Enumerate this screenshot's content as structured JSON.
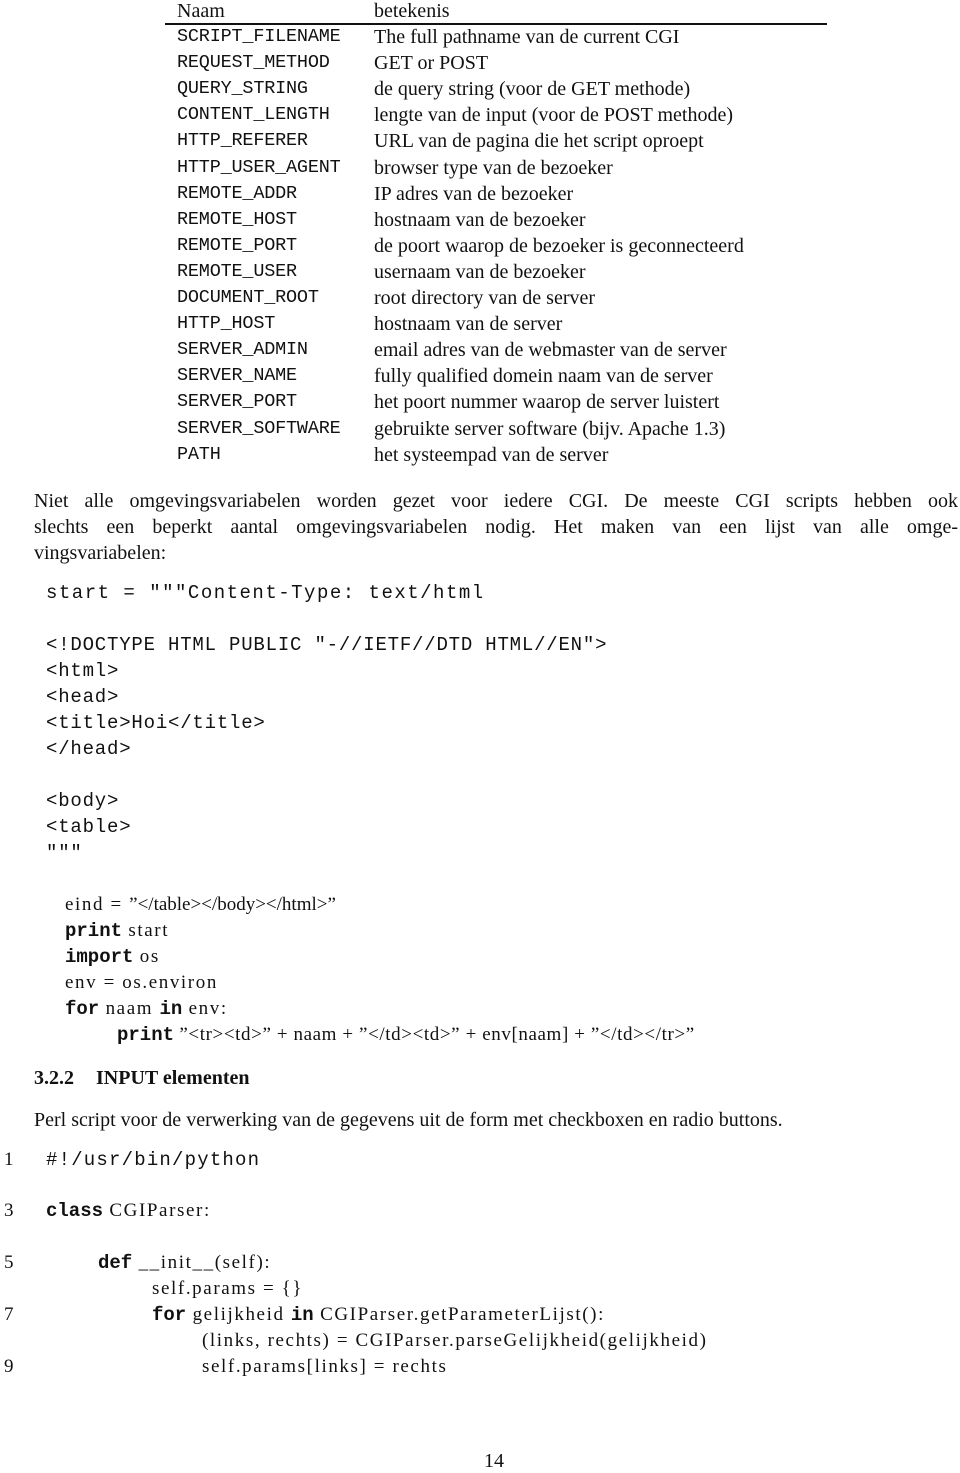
{
  "env_table": {
    "headers": {
      "name": "Naam",
      "meaning": "betekenis"
    },
    "rows": [
      {
        "name": "SCRIPT_FILENAME",
        "meaning": "The full pathname van de current CGI"
      },
      {
        "name": "REQUEST_METHOD",
        "meaning": "GET or POST"
      },
      {
        "name": "QUERY_STRING",
        "meaning": "de query string (voor de GET methode)"
      },
      {
        "name": "CONTENT_LENGTH",
        "meaning": "lengte van de input (voor de POST methode)"
      },
      {
        "name": "HTTP_REFERER",
        "meaning": "URL van de pagina die het script oproept"
      },
      {
        "name": "HTTP_USER_AGENT",
        "meaning": "browser type van de bezoeker"
      },
      {
        "name": "REMOTE_ADDR",
        "meaning": "IP adres van de bezoeker"
      },
      {
        "name": "REMOTE_HOST",
        "meaning": "hostnaam van de bezoeker"
      },
      {
        "name": "REMOTE_PORT",
        "meaning": "de poort waarop de bezoeker is geconnecteerd"
      },
      {
        "name": "REMOTE_USER",
        "meaning": "usernaam van de bezoeker"
      },
      {
        "name": "DOCUMENT_ROOT",
        "meaning": "root directory van de server"
      },
      {
        "name": "HTTP_HOST",
        "meaning": "hostnaam van de server"
      },
      {
        "name": "SERVER_ADMIN",
        "meaning": "email adres van de webmaster van de server"
      },
      {
        "name": "SERVER_NAME",
        "meaning": "fully qualified domein naam van de server"
      },
      {
        "name": "SERVER_PORT",
        "meaning": "het poort nummer waarop de server luistert"
      },
      {
        "name": "SERVER_SOFTWARE",
        "meaning": "gebruikte server software (bijv. Apache 1.3)"
      },
      {
        "name": "PATH",
        "meaning": "het systeempad van de server"
      }
    ]
  },
  "paragraph1": {
    "lines": [
      "Niet alle omgevingsvariabelen worden gezet voor iedere CGI. De meeste CGI scripts hebben ook",
      "slechts een beperkt aantal omgevingsvariabelen nodig. Het maken van een lijst van alle omge-",
      "vingsvariabelen:"
    ]
  },
  "code1": {
    "start_line": "start = \"\"\"Content-Type: text/html",
    "html_lines": [
      "<!DOCTYPE HTML PUBLIC \"-//IETF//DTD HTML//EN\">",
      "<html>",
      "<head>",
      "<title>Hoi</title>",
      "</head>",
      "",
      "<body>",
      "<table>",
      "\"\"\""
    ],
    "eind": {
      "var": "eind = ",
      "value": "”</table></body></html>”"
    },
    "print_start": {
      "kw": "print",
      "rest": " start"
    },
    "import_os": {
      "kw": "import",
      "rest": " os"
    },
    "env_line": "env = os.environ",
    "for_line": {
      "kw1": "for",
      "mid": " naam ",
      "kw2": "in",
      "rest": " env:"
    },
    "print_row": {
      "kw": "print",
      "rest": " ”<tr><td>” + naam + ”</td><td>” + env[naam] + ”</td></tr>”"
    }
  },
  "section": {
    "number": "3.2.2",
    "title": "INPUT elementen"
  },
  "paragraph2": "Perl script voor de verwerking van de gegevens uit de form met checkboxen en radio buttons.",
  "code2": {
    "lines": [
      {
        "no": "1",
        "parts": [
          {
            "t": "#!/usr/bin/python",
            "c": "tt"
          }
        ]
      },
      {
        "no": "3",
        "parts": [
          {
            "t": "class",
            "c": "kw"
          },
          {
            "t": " CGIParser:",
            "c": "id"
          }
        ]
      },
      {
        "no": "5",
        "parts": [
          {
            "t": "def",
            "c": "kw"
          },
          {
            "t": " __init__(self):",
            "c": "id"
          }
        ]
      },
      {
        "no": "",
        "parts": [
          {
            "t": "self.params = {}",
            "c": "id"
          }
        ]
      },
      {
        "no": "7",
        "parts": [
          {
            "t": "for",
            "c": "kw"
          },
          {
            "t": " gelijkheid ",
            "c": "id"
          },
          {
            "t": "in",
            "c": "kw"
          },
          {
            "t": " CGIParser.getParameterLijst():",
            "c": "id"
          }
        ]
      },
      {
        "no": "",
        "parts": [
          {
            "t": "(links, rechts) = CGIParser.parseGelijkheid(gelijkheid)",
            "c": "id"
          }
        ]
      },
      {
        "no": "9",
        "parts": [
          {
            "t": "self.params[links] = rechts",
            "c": "id"
          }
        ]
      }
    ]
  },
  "page_number": "14"
}
